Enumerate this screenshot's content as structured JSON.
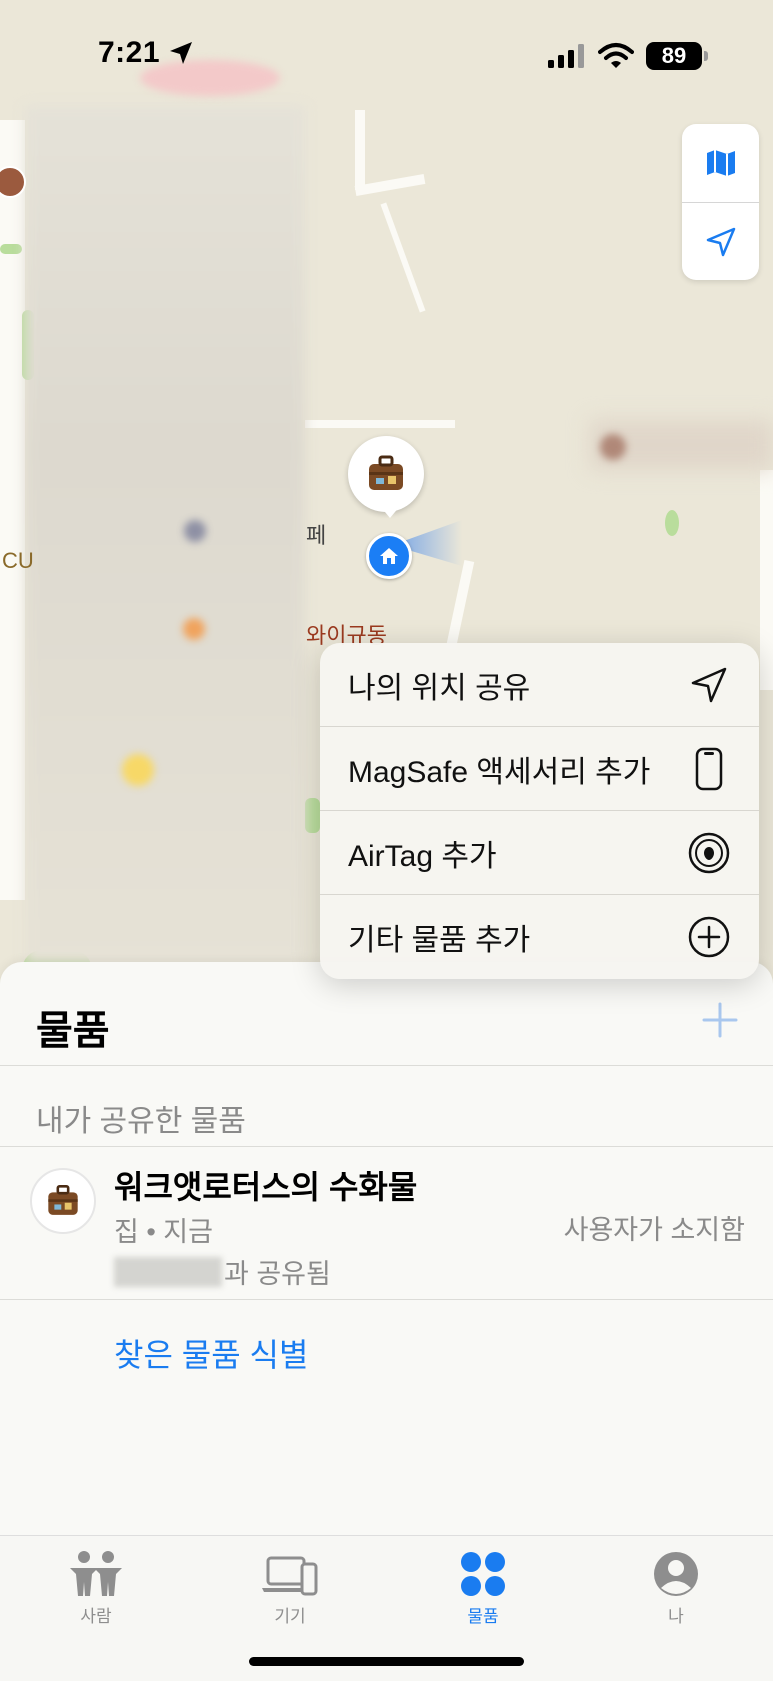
{
  "status_bar": {
    "time": "7:21",
    "battery": "89"
  },
  "map": {
    "labels": {
      "pe": "페",
      "waigyu": "와이규동",
      "cu": "CU"
    },
    "controls": [
      "map-icon",
      "location-arrow-icon"
    ]
  },
  "menu": {
    "items": [
      {
        "label": "나의 위치 공유",
        "icon": "location-arrow-icon"
      },
      {
        "label": "MagSafe 액세서리 추가",
        "icon": "phone-icon"
      },
      {
        "label": "AirTag 추가",
        "icon": "airtag-icon"
      },
      {
        "label": "기타 물품 추가",
        "icon": "plus-circle-icon"
      }
    ]
  },
  "sheet": {
    "title": "물품",
    "section_header": "내가 공유한 물품",
    "item": {
      "name": "워크앳로터스의 수화물",
      "subtitle": "집 • 지금",
      "shared_suffix": "과 공유됨",
      "owner_status": "사용자가 소지함"
    },
    "identify_link": "찾은 물품 식별"
  },
  "tabbar": {
    "tabs": [
      {
        "label": "사람",
        "icon": "people-icon",
        "active": false
      },
      {
        "label": "기기",
        "icon": "devices-icon",
        "active": false
      },
      {
        "label": "물품",
        "icon": "items-icon",
        "active": true
      },
      {
        "label": "나",
        "icon": "person-icon",
        "active": false
      }
    ]
  },
  "colors": {
    "accent": "#1a7cf0",
    "home_dot": "#1b7ef5",
    "map_bg": "#ebe7d8"
  }
}
